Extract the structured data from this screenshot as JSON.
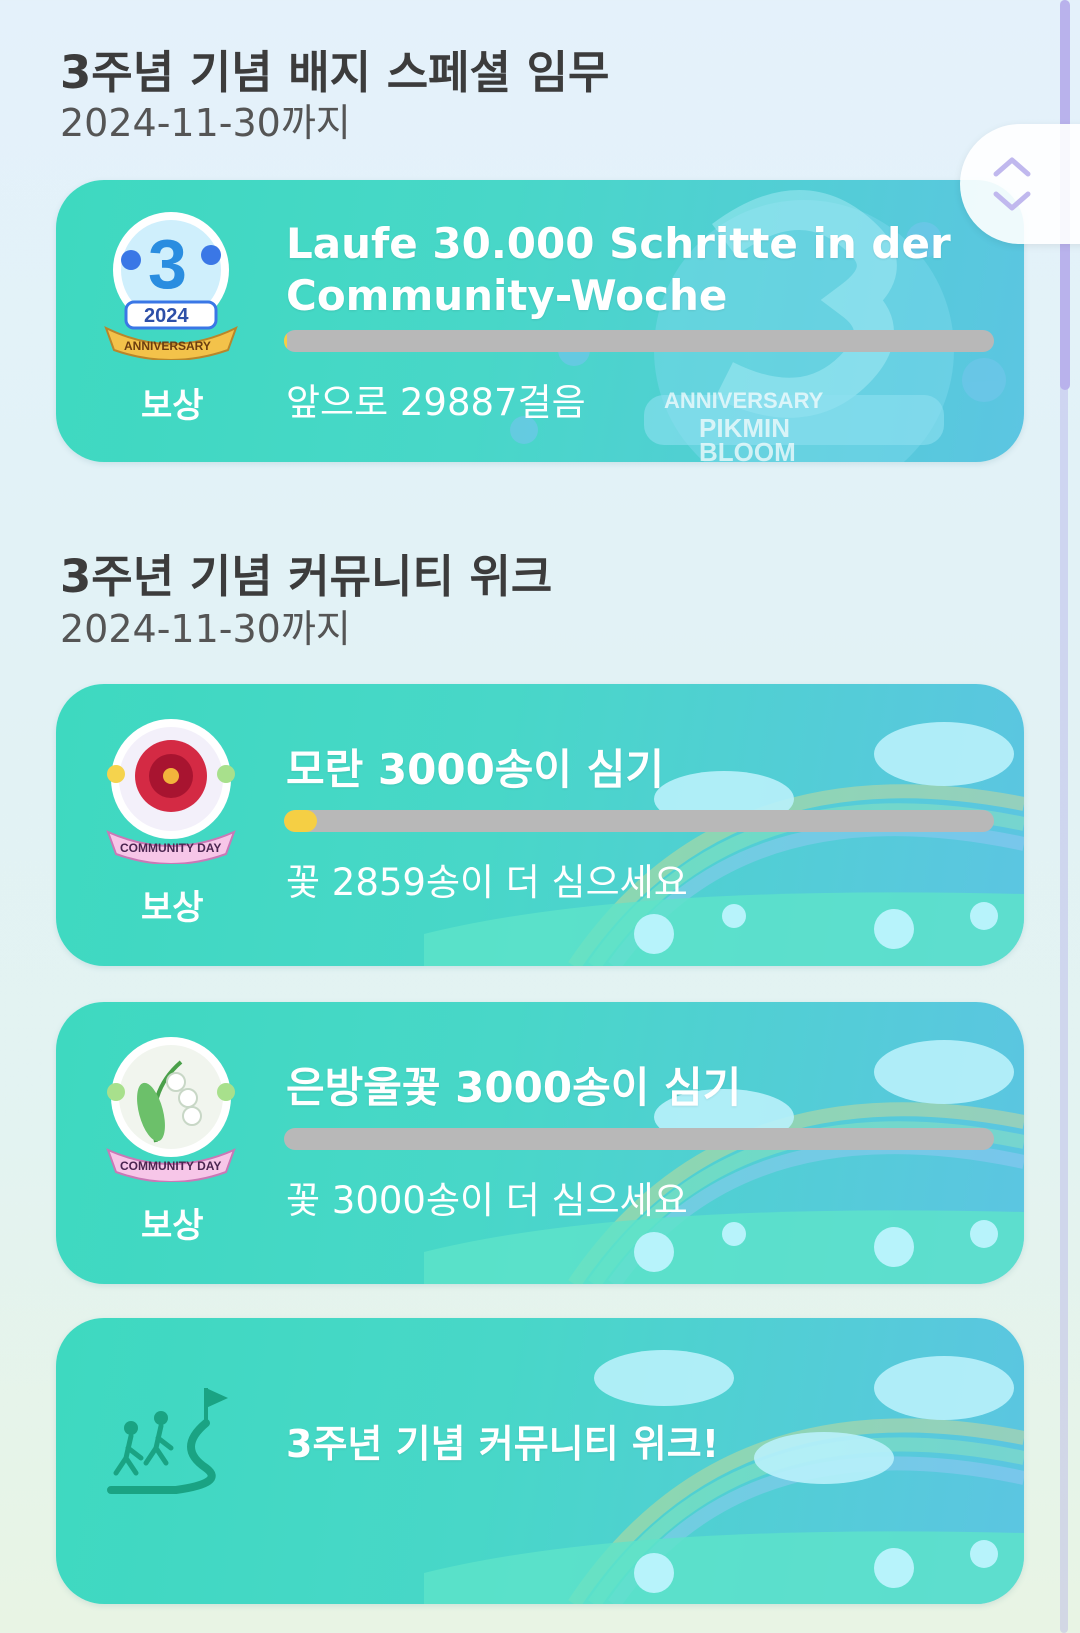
{
  "sections": [
    {
      "title": "3주념 기념 배지 스페셜 임무",
      "date": "2024-11-30까지",
      "cards": [
        {
          "reward_label": "보상",
          "title_line1": "Laufe 30.000 Schritte in der",
          "title_line2": "Community-Woche",
          "progress": 0.004,
          "remaining": "앞으로 29887걸음",
          "badge_icon": "anniversary-2024-badge-icon",
          "badge_text_year": "2024",
          "badge_text_banner": "ANNIVERSARY",
          "bg_text_1": "ANNIVERSARY",
          "bg_text_2": "PIKMIN",
          "bg_text_3": "BLOOM"
        }
      ]
    },
    {
      "title": "3주년 기념 커뮤니티 위크",
      "date": "2024-11-30까지",
      "cards": [
        {
          "reward_label": "보상",
          "title": "모란 3000송이 심기",
          "progress": 0.047,
          "remaining": "꽃 2859송이 더 심으세요",
          "badge_icon": "peony-community-day-badge-icon",
          "badge_banner": "COMMUNITY DAY"
        },
        {
          "reward_label": "보상",
          "title": "은방울꽃 3000송이 심기",
          "progress": 0.0,
          "remaining": "꽃 3000송이 더 심으세요",
          "badge_icon": "lily-of-the-valley-community-day-badge-icon",
          "badge_banner": "COMMUNITY DAY"
        },
        {
          "title": "3주년 기념 커뮤니티 위크!",
          "icon": "walking-people-flag-icon"
        }
      ]
    }
  ],
  "colors": {
    "card_start": "#3ed9c0",
    "card_end": "#5cc5e2",
    "progress_fill": "#f5cf44",
    "progress_track": "#b8b8b8"
  },
  "scroll_button_icon": "chevron-up-down-icon"
}
